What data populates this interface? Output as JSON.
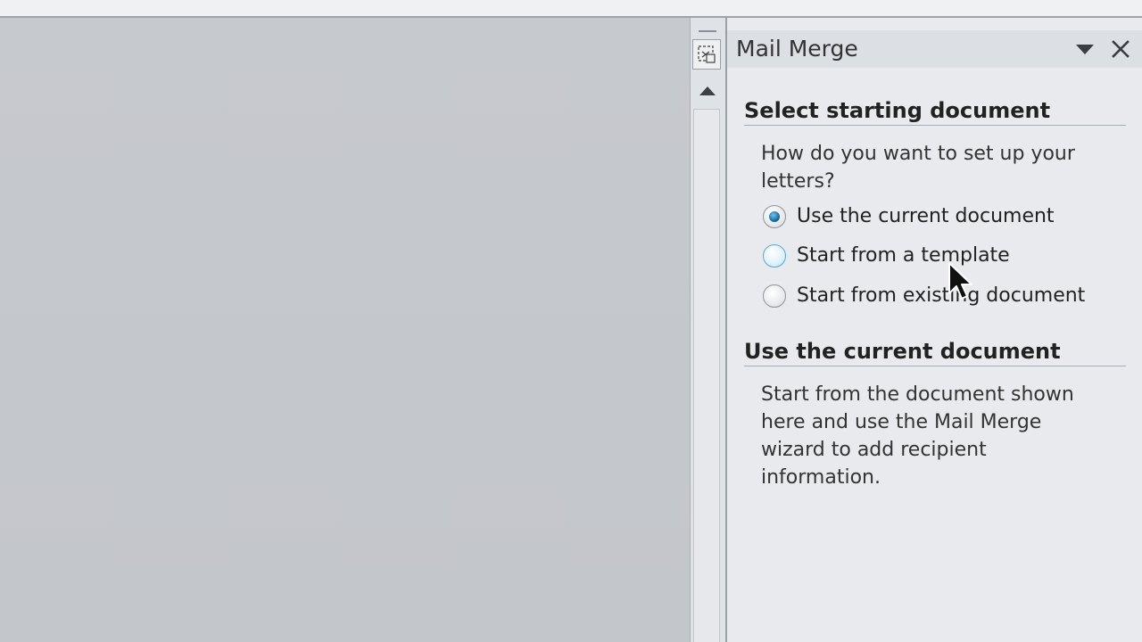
{
  "task_pane": {
    "title": "Mail Merge",
    "menu_icon": "chevron-down-icon",
    "close_icon": "close-icon"
  },
  "select_section": {
    "heading": "Select starting document",
    "question": "How do you want to set up your letters?",
    "options": [
      {
        "label": "Use the current document",
        "checked": true
      },
      {
        "label": "Start from a template",
        "checked": false
      },
      {
        "label": "Start from existing document",
        "checked": false
      }
    ]
  },
  "description_section": {
    "heading": "Use the current document",
    "text": "Start from the document shown here and use the Mail Merge wizard to add recipient information."
  },
  "colors": {
    "accent_radio": "#1a6f9e",
    "pane_background": "#e8eaed",
    "document_background": "#c6c9ce"
  }
}
